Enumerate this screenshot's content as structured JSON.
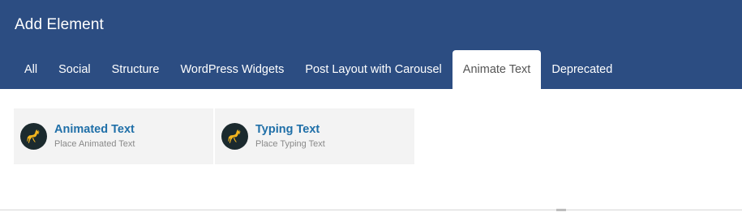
{
  "dialog": {
    "title": "Add Element"
  },
  "tabs": [
    {
      "label": "All"
    },
    {
      "label": "Social"
    },
    {
      "label": "Structure"
    },
    {
      "label": "WordPress Widgets"
    },
    {
      "label": "Post Layout with Carousel"
    },
    {
      "label": "Animate Text",
      "active": true
    },
    {
      "label": "Deprecated"
    }
  ],
  "elements": [
    {
      "title": "Animated Text",
      "subtitle": "Place Animated Text",
      "icon": "deer-icon"
    },
    {
      "title": "Typing Text",
      "subtitle": "Place Typing Text",
      "icon": "deer-icon"
    }
  ],
  "colors": {
    "header": "#2c4d82",
    "link": "#1f6fa8",
    "icon_bg": "#1b2a2e",
    "icon_fg": "#f2b51e"
  }
}
